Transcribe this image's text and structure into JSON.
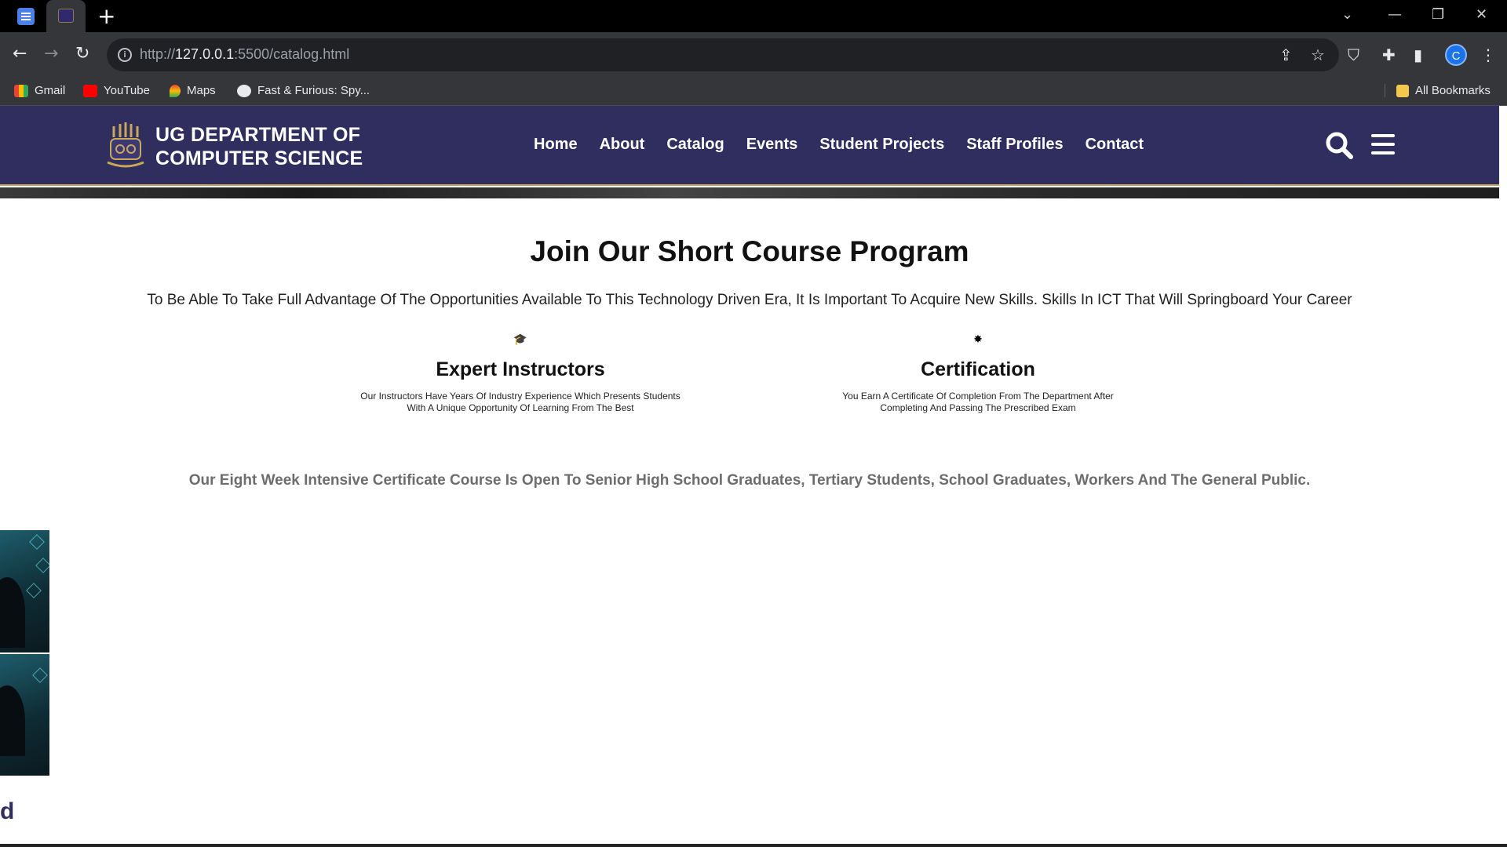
{
  "browser": {
    "url_prefix": "http://",
    "url_host": "127.0.0.1",
    "url_rest": ":5500/catalog.html",
    "bookmarks": [
      {
        "label": "Gmail",
        "icon": "gmail-icon"
      },
      {
        "label": "YouTube",
        "icon": "youtube-icon"
      },
      {
        "label": "Maps",
        "icon": "maps-icon"
      },
      {
        "label": "Fast & Furious: Spy...",
        "icon": "globe-icon"
      }
    ],
    "all_bookmarks_label": "All Bookmarks",
    "profile_initial": "C"
  },
  "header": {
    "brand_line1": "UG DEPARTMENT OF",
    "brand_line2": "COMPUTER SCIENCE",
    "nav": [
      "Home",
      "About",
      "Catalog",
      "Events",
      "Student Projects",
      "Staff Profiles",
      "Contact"
    ]
  },
  "main": {
    "title": "Join Our Short Course Program",
    "subtitle": "To Be Able To Take Full Advantage Of The Opportunities Available To This Technology Driven Era, It Is Important To Acquire New Skills. Skills In ICT That Will Springboard Your Career",
    "features": [
      {
        "icon": "graduation-cap-icon",
        "glyph": "🎓",
        "title": "Expert Instructors",
        "text_line1": "Our Instructors Have Years Of Industry Experience Which Presents Students",
        "text_line2": "With A Unique Opportunity Of Learning From The Best"
      },
      {
        "icon": "certificate-icon",
        "glyph": "✸",
        "title": "Certification",
        "text_line1": "You Earn A Certificate Of Completion From The Department After",
        "text_line2": "Completing And Passing The Prescribed Exam"
      }
    ],
    "open_note": "Our Eight Week Intensive Certificate Course Is Open To Senior High School Graduates, Tertiary Students, School Graduates, Workers And The General Public.",
    "edge_text": "d"
  },
  "colors": {
    "header_bg": "#2f2e5e",
    "header_accent": "#c9a85b",
    "note_text": "#6d6d6d"
  }
}
